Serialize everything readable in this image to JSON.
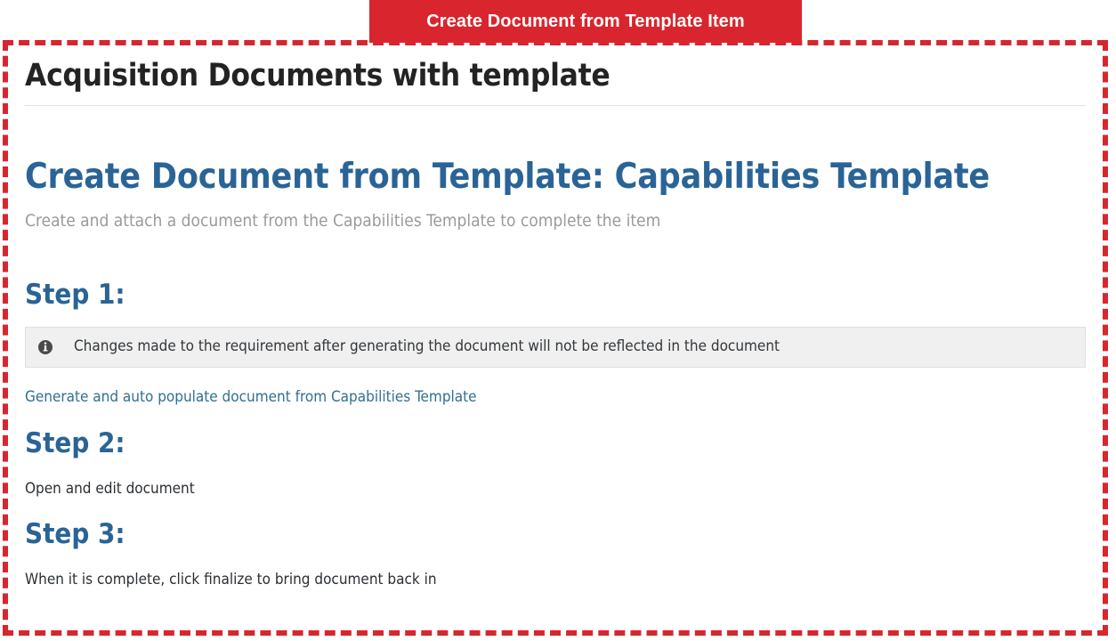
{
  "annotation": {
    "banner_label": "Create Document from Template Item",
    "banner_color": "#d9252d",
    "frame_color": "#d9252d"
  },
  "page": {
    "title": "Acquisition Documents with template"
  },
  "document": {
    "heading": "Create Document from Template: Capabilities Template",
    "subheading": "Create and attach a document from the Capabilities Template to complete the item",
    "heading_color": "#2a6496",
    "subheading_color": "#9a9a9a"
  },
  "steps": [
    {
      "heading": "Step 1:",
      "alert": {
        "icon": "info-circle-icon",
        "text": "Changes made to the requirement after generating the document will not be reflected in the document",
        "background": "#f0f0f0"
      },
      "link": "Generate and auto populate document from Capabilities Template",
      "link_color": "#31708f"
    },
    {
      "heading": "Step 2:",
      "text": "Open and edit document"
    },
    {
      "heading": "Step 3:",
      "text": "When it is complete, click finalize to bring document back in"
    }
  ]
}
